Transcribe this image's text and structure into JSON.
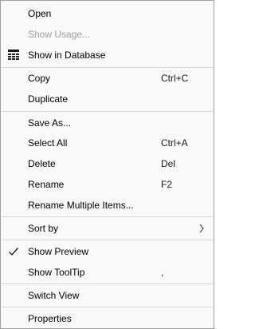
{
  "menu": {
    "items": [
      {
        "label": "Open"
      },
      {
        "label": "Show Usage..."
      },
      {
        "label": "Show in Database"
      },
      {
        "label": "Copy",
        "shortcut": "Ctrl+C"
      },
      {
        "label": "Duplicate"
      },
      {
        "label": "Save As..."
      },
      {
        "label": "Select All",
        "shortcut": "Ctrl+A"
      },
      {
        "label": "Delete",
        "shortcut": "Del"
      },
      {
        "label": "Rename",
        "shortcut": "F2"
      },
      {
        "label": "Rename Multiple Items..."
      },
      {
        "label": "Sort by"
      },
      {
        "label": "Show Preview"
      },
      {
        "label": "Show ToolTip",
        "shortcut": ","
      },
      {
        "label": "Switch View"
      },
      {
        "label": "Properties"
      }
    ]
  },
  "colors": {
    "background": "#f9f9f9",
    "border": "#a0a0a0",
    "separator": "#d7d7d7",
    "disabled_text": "#a0a0a0"
  },
  "icons": {
    "show_in_database": "database-grid-icon",
    "sort_by": "chevron-right-icon",
    "show_preview": "checkmark-icon"
  }
}
